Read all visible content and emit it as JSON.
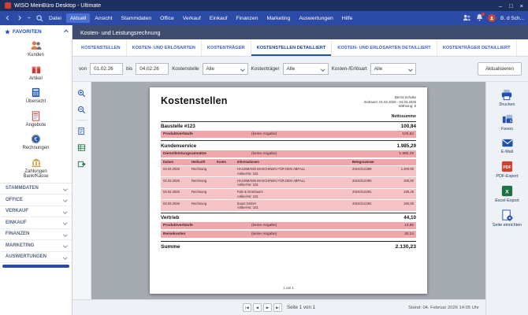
{
  "window": {
    "title": "WISO MeinBüro Desktop - Ultimate",
    "min": "–",
    "max": "□",
    "close": "×"
  },
  "menubar": {
    "plus": "+",
    "items": [
      "Datei",
      "Aktuell",
      "Ansicht",
      "Stammdaten",
      "Office",
      "Verkauf",
      "Einkauf",
      "Finanzen",
      "Marketing",
      "Auswertungen",
      "Hilfe"
    ],
    "user": "B. d Sch..."
  },
  "sidebar": {
    "favorites_label": "FAVORITEN",
    "favorites": [
      {
        "label": "Kunden"
      },
      {
        "label": "Artikel"
      },
      {
        "label": "Übersicht"
      },
      {
        "label": "Angebote"
      },
      {
        "label": "Rechnungen"
      },
      {
        "label": "Zahlungen Bank/Kasse"
      }
    ],
    "sections": [
      {
        "label": "STAMMDATEN"
      },
      {
        "label": "OFFICE"
      },
      {
        "label": "VERKAUF"
      },
      {
        "label": "EINKAUF"
      },
      {
        "label": "FINANZEN"
      },
      {
        "label": "MARKETING"
      },
      {
        "label": "AUSWERTUNGEN"
      }
    ]
  },
  "header": {
    "title": "Kosten- und Leistungsrechnung"
  },
  "tabs": [
    {
      "label": "KOSTENSTELLEN"
    },
    {
      "label": "KOSTEN- UND ERLÖSARTEN"
    },
    {
      "label": "KOSTENTRÄGER"
    },
    {
      "label": "KOSTENSTELLEN DETAILLIERT"
    },
    {
      "label": "KOSTEN- UND ERLÖSARTEN DETAILLIERT"
    },
    {
      "label": "KOSTENTRÄGER DETAILLIERT"
    }
  ],
  "filters": {
    "von_label": "von",
    "von_value": "01.02.26",
    "bis_label": "bis",
    "bis_value": "04.02.26",
    "kostenstelle_label": "Kostenstelle",
    "kostenstelle_value": "Alle",
    "kostentraeger_label": "Kostenträger",
    "kostentraeger_value": "Alle",
    "kostenart_label": "Kosten-/Erlösart",
    "kostenart_value": "Alle",
    "refresh_label": "Aktualisieren"
  },
  "document": {
    "title": "Kostenstellen",
    "meta_name": "Bernd Schulte",
    "meta_period": "Zeitraum: 01.02.2026 - 04.02.2026",
    "meta_currency": "Währung: €",
    "netto_label": "Nettosumme",
    "sections": [
      {
        "name": "Baustelle #123",
        "value": "100,84",
        "subrows": [
          {
            "name": "Produktverkäufe",
            "note": "(keine Angabe)",
            "value": "100,84"
          }
        ]
      },
      {
        "name": "Kundenservice",
        "value": "1.985,29",
        "subrows": [
          {
            "name": "Dienstleistungsumsätze",
            "note": "(keine Angabe)",
            "value": "1.985,29"
          }
        ],
        "table": {
          "headers": {
            "datum": "Datum",
            "herkunft": "Herkunft",
            "konto": "Konto",
            "info": "Informationen",
            "beleg": "Belegnummer"
          },
          "rows": [
            {
              "datum": "04.02.2026",
              "herkunft": "Rechnung",
              "konto": "",
              "info": "HAUSMANN MASCHINEN FÜR DEN ABFALL",
              "info2": "Artikel-Nr: 101",
              "beleg": "2024/212289",
              "value": "1.300,00"
            },
            {
              "datum": "04.02.2026",
              "herkunft": "Rechnung",
              "konto": "",
              "info": "HAUSMANN MASCHINEN FÜR DEN ABFALL",
              "info2": "Artikel-Nr: 101",
              "beleg": "2024/212290",
              "value": "200,00"
            },
            {
              "datum": "04.02.2026",
              "herkunft": "Rechnung",
              "konto": "",
              "info": "Falz & Grünbaum",
              "info2": "Artikel-Nr: 101",
              "beleg": "2024/212291",
              "value": "235,29"
            },
            {
              "datum": "04.02.2026",
              "herkunft": "Rechnung",
              "konto": "",
              "info": "Exact GmbH",
              "info2": "Artikel-Nr: 101",
              "beleg": "2024/212292",
              "value": "250,00"
            }
          ]
        }
      },
      {
        "name": "Vertrieb",
        "value": "44,10",
        "subrows": [
          {
            "name": "Produktverkäufe",
            "note": "(keine Angabe)",
            "value": "13,86"
          },
          {
            "name": "Reisekosten",
            "note": "(keine Angabe)",
            "value": "30,24"
          }
        ]
      }
    ],
    "summe_label": "Summe",
    "summe_value": "2.130,23",
    "page_footer": "1 von 1"
  },
  "statusbar": {
    "pager_first": "|◀",
    "pager_prev": "◀",
    "pager_next": "▶",
    "pager_last": "▶|",
    "page_text": "Seite 1 von 1",
    "stand_text": "Stand: 04. Februar 2026 14:05 Uhr"
  },
  "actions": [
    {
      "label": "Drucken"
    },
    {
      "label": "Faxen"
    },
    {
      "label": "E-Mail"
    },
    {
      "label": "PDF-Export"
    },
    {
      "label": "Excel-Export"
    },
    {
      "label": "Seite einrichten"
    }
  ]
}
